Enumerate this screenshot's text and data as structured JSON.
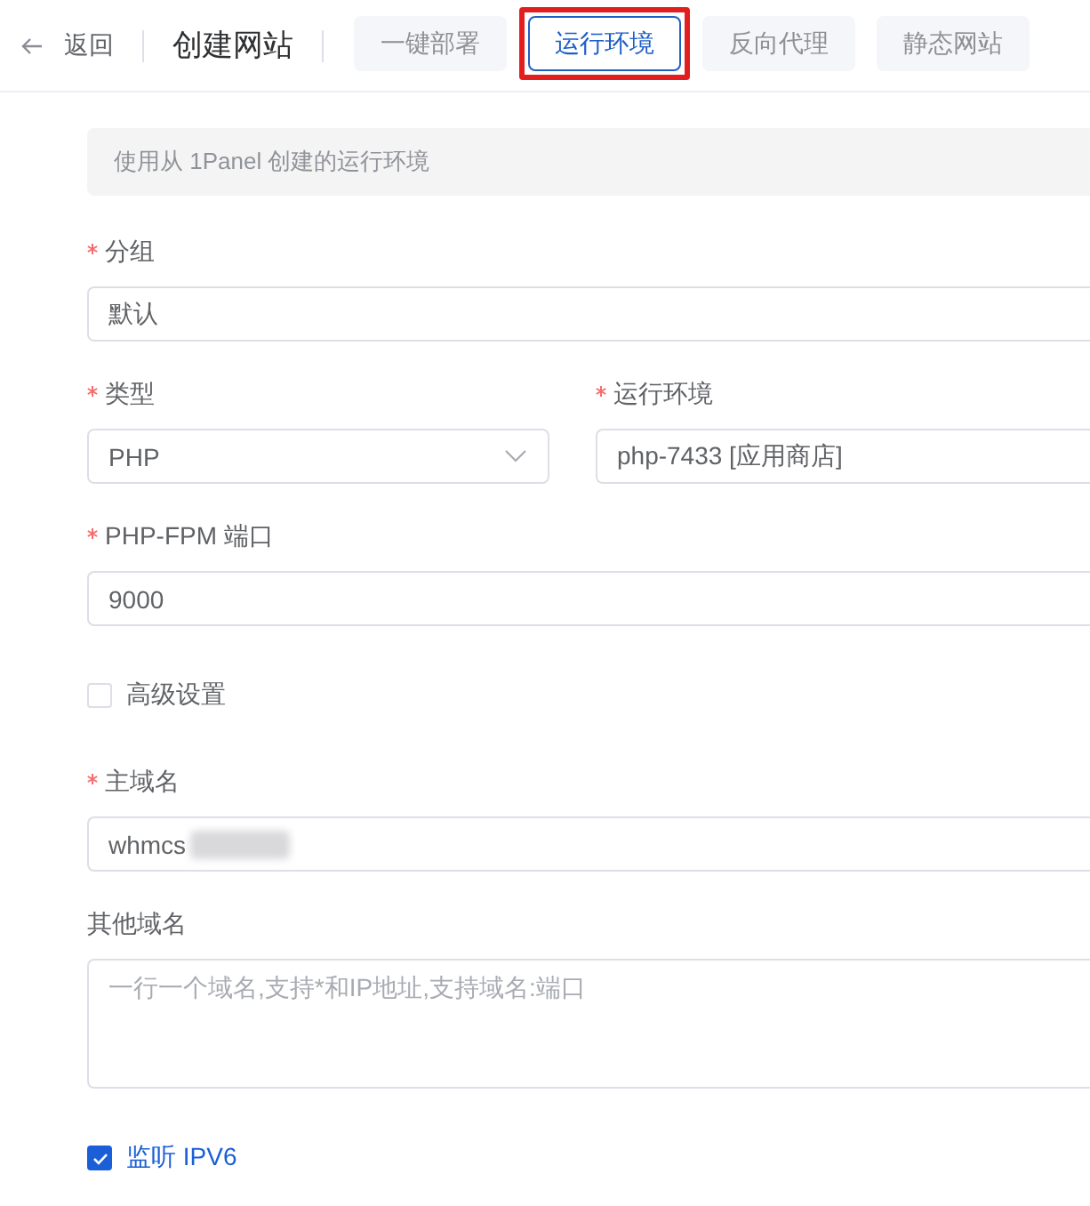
{
  "header": {
    "back_label": "返回",
    "title": "创建网站"
  },
  "tabs": [
    {
      "label": "一键部署",
      "selected": false,
      "highlighted": false
    },
    {
      "label": "运行环境",
      "selected": true,
      "highlighted": true
    },
    {
      "label": "反向代理",
      "selected": false,
      "highlighted": false
    },
    {
      "label": "静态网站",
      "selected": false,
      "highlighted": false
    }
  ],
  "notice": {
    "text": "使用从 1Panel 创建的运行环境"
  },
  "form": {
    "rows": [
      {
        "fields": [
          {
            "kind": "input",
            "label": "分组",
            "required": true,
            "value": "默认",
            "blurred": false
          }
        ]
      },
      {
        "fields": [
          {
            "kind": "select",
            "label": "类型",
            "required": true,
            "value": "PHP",
            "blurred": false
          },
          {
            "kind": "input",
            "label": "运行环境",
            "required": true,
            "value": "php-7433 [应用商店]",
            "blurred": false
          }
        ]
      },
      {
        "fields": [
          {
            "kind": "input",
            "label": "PHP-FPM 端口",
            "required": true,
            "value": "9000",
            "blurred": false
          }
        ]
      },
      {
        "fields": [
          {
            "kind": "checkbox",
            "label": "高级设置",
            "checked": false
          }
        ]
      },
      {
        "fields": [
          {
            "kind": "input",
            "label": "主域名",
            "required": true,
            "value": "whmcs",
            "blurred": true
          }
        ]
      },
      {
        "fields": [
          {
            "kind": "textarea",
            "label": "其他域名",
            "required": false,
            "placeholder": "一行一个域名,支持*和IP地址,支持域名:端口"
          }
        ]
      },
      {
        "fields": [
          {
            "kind": "checkbox",
            "label": "监听 IPV6",
            "checked": true
          }
        ]
      }
    ]
  }
}
